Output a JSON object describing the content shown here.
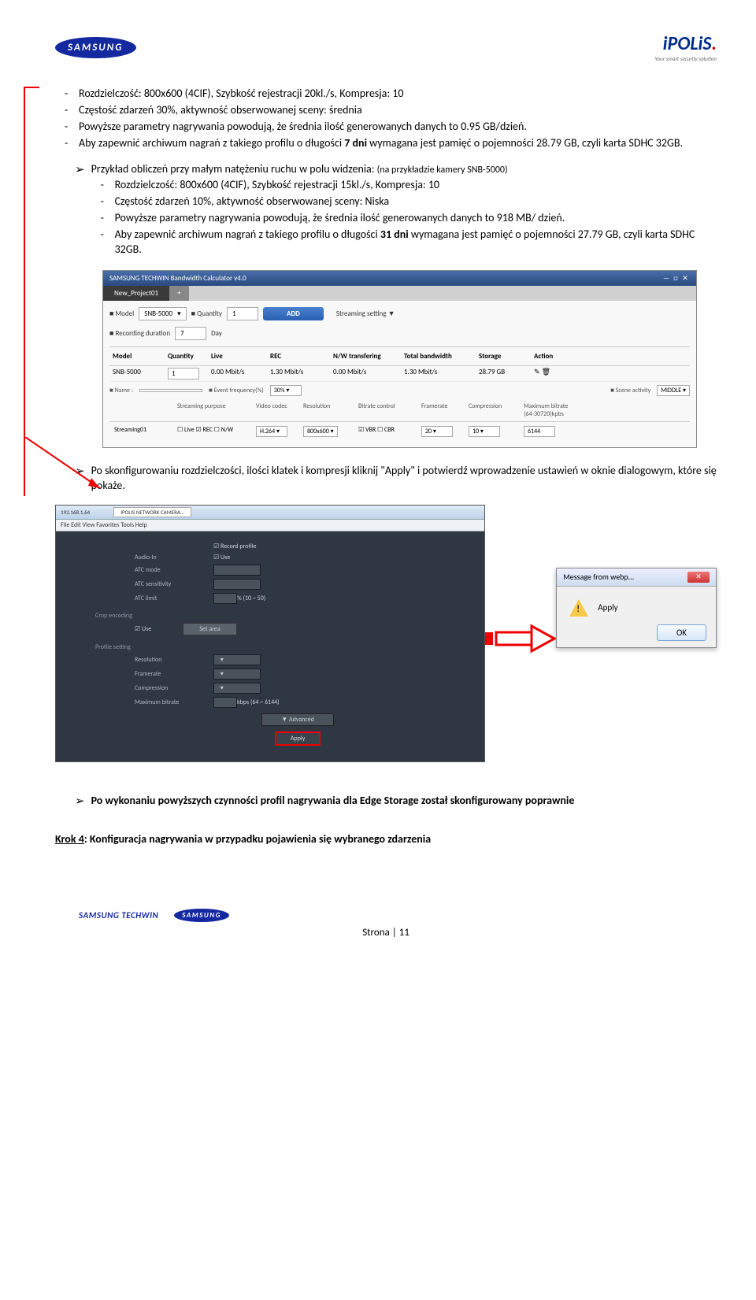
{
  "header": {
    "samsung": "SAMSUNG",
    "ipolis_main": "iPOLiS",
    "ipolis_dot": ".",
    "ipolis_sub": "Your smart security solution"
  },
  "block1": {
    "li1": "Rozdzielczość: 800x600 (4CIF), Szybkość rejestracji 20kl./s, Kompresja: 10",
    "li2": "Częstość zdarzeń 30%, aktywność obserwowanej sceny: średnia",
    "li3": "Powyższe parametry nagrywania powodują, że średnia ilość generowanych danych to 0.95 GB/dzień.",
    "li4a": "Aby zapewnić archiwum nagrań z takiego profilu o długości ",
    "li4b": "7 dni",
    "li4c": " wymagana jest pamięć o pojemności 28.79 GB, czyli karta SDHC 32GB."
  },
  "block2": {
    "lead": "Przykład obliczeń przy małym natężeniu ruchu w polu widzenia: ",
    "lead_note": "(na przykładzie kamery SNB-5000)",
    "li1": "Rozdzielczość: 800x600 (4CIF), Szybkość rejestracji 15kl./s, Kompresja: 10",
    "li2": "Częstość zdarzeń 10%, aktywność obserwowanej sceny: Niska",
    "li3": "Powyższe parametry nagrywania powodują, że średnia ilość generowanych danych to 918 MB/ dzień.",
    "li4a": "Aby zapewnić archiwum nagrań z takiego profilu o długości ",
    "li4b": "31 dni",
    "li4c": " wymagana jest pamięć o pojemności 27.79 GB, czyli karta SDHC 32GB."
  },
  "calc": {
    "title": "SAMSUNG TECHWIN   Bandwidth Calculator v4.0",
    "tab": "New_Project01",
    "model_label": "Model",
    "model_value": "SNB-5000",
    "qty_label": "Quantity",
    "qty_value": "1",
    "add": "ADD",
    "streaming": "Streaming setting  ▼",
    "recdur_label": "Recording duration",
    "recdur_value": "7",
    "recdur_unit": "Day",
    "headers": [
      "Model",
      "Quantity",
      "Live",
      "REC",
      "N/W transfering",
      "Total bandwidth",
      "Storage",
      "Action"
    ],
    "row": [
      "SNB-5000",
      "1",
      "0.00 Mbit/s",
      "1.30 Mbit/s",
      "0.00 Mbit/s",
      "1.30 Mbit/s",
      "28.79 GB",
      ""
    ],
    "name_label": "Name :",
    "eventfreq_label": "Event frequency(%)",
    "eventfreq_value": "30%",
    "scene_label": "Scene activity",
    "scene_value": "MIDDLE",
    "enc_headers": [
      "",
      "Streaming purpose",
      "Video codec",
      "Resolution",
      "Bitrate control",
      "Framerate",
      "Compression",
      "Maximum bitrate (64-30720)kpbs"
    ],
    "enc_row": {
      "name": "Streaming01",
      "purpose": "☐ Live ☑ REC ☐ N/W",
      "codec": "H.264",
      "res": "800x600",
      "bitrate": "☑ VBR  ☐ CBR",
      "framerate": "20",
      "compression": "10",
      "maxbitrate": "6144"
    }
  },
  "bullet3": "Po skonfigurowaniu rozdzielczości, ilości klatek i kompresji kliknij \"Apply\" i potwierdź wprowadzenie ustawień w oknie dialogowym, które się pokaże.",
  "settings": {
    "url": "192.168.1.64",
    "tab": "IPOLIS NETWORK CAMERA...",
    "menu": "File  Edit  View  Favorites  Tools  Help",
    "record_profile": "Record profile",
    "audio_in": "Audio-In",
    "audio_in_v": "Use",
    "atc_mode": "ATC mode",
    "atc_sens": "ATC sensitivity",
    "atc_limit": "ATC limit",
    "atc_limit_v": "% (10 ~ 50)",
    "crop": "Crop encoding",
    "use": "Use",
    "setarea": "Set area",
    "profile": "Profile setting",
    "resolution": "Resolution",
    "framerate": "Framerate",
    "compression": "Compression",
    "maxbitrate": "Maximum bitrate",
    "maxbitrate_hint": "kbps (64 ~ 6144)",
    "advanced": "▼  Advanced",
    "apply": "Apply"
  },
  "dialog": {
    "title": "Message from webp...",
    "text": "Apply",
    "ok": "OK"
  },
  "bullet4": "Po wykonaniu powyższych czynności profil nagrywania dla Edge Storage został skonfigurowany poprawnie",
  "krok": {
    "label": "Krok 4",
    "text": ": Konfiguracja nagrywania w przypadku pojawienia się wybranego zdarzenia"
  },
  "footer": {
    "techwin": "SAMSUNG TECHWIN",
    "samsung": "SAMSUNG",
    "page": "Strona | 11"
  }
}
